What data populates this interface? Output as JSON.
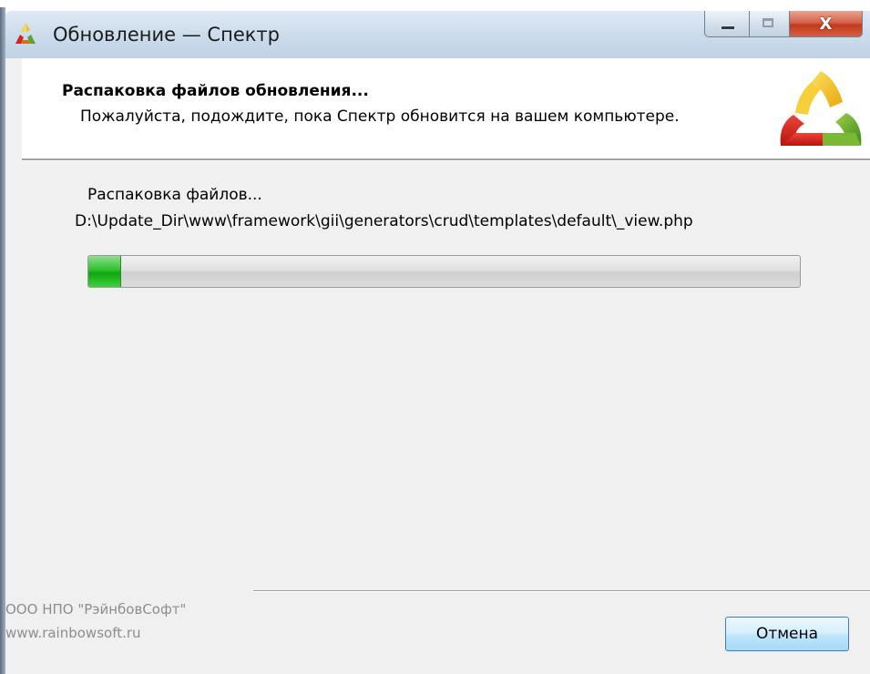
{
  "window": {
    "title": "Обновление — Спектр",
    "controls": {
      "minimize_icon": "minimize-icon",
      "maximize_icon": "maximize-icon",
      "close_symbol": "X"
    }
  },
  "header": {
    "title": "Распаковка файлов обновления...",
    "subtitle": "Пожалуйста, подождите, пока Спектр обновится на вашем компьютере.",
    "logo_icon": "spectr-logo-icon"
  },
  "main": {
    "status": "Распаковка файлов...",
    "current_file": "D:\\Update_Dir\\www\\framework\\gii\\generators\\crud\\templates\\default\\_view.php",
    "progress_fraction": 0.045
  },
  "footer": {
    "company": "ООО НПО \"РэйнбовСофт\"",
    "website": "www.rainbowsoft.ru",
    "cancel_label": "Отмена"
  },
  "colors": {
    "progress_green": "#1fb51f",
    "titlebar": "#cddcec",
    "close_red": "#c23a1d",
    "button_border": "#3c7fb1",
    "logo_yellow": "#f3c21a",
    "logo_red": "#d6261c",
    "logo_green": "#5aa62c"
  }
}
